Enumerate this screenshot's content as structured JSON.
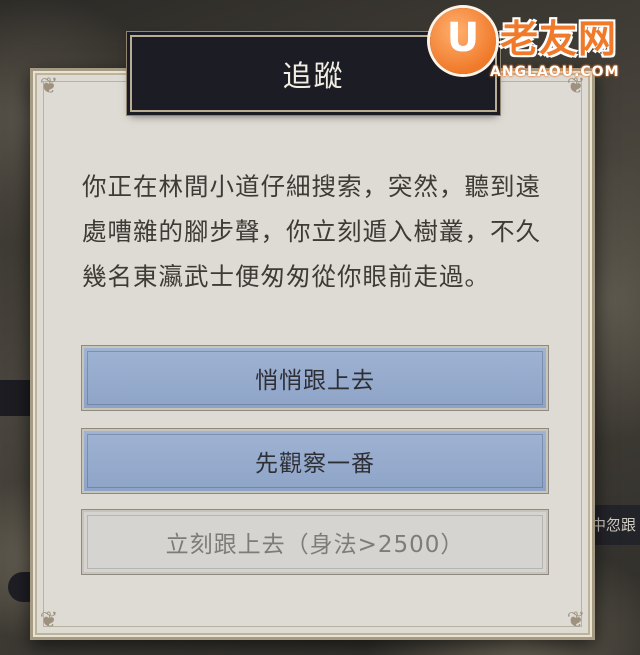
{
  "dialog": {
    "title": "追蹤",
    "description": "你正在林間小道仔細搜索，突然，聽到遠處嘈雜的腳步聲，你立刻遁入樹叢，不久幾名東瀛武士便匆匆從你眼前走過。",
    "choices": [
      {
        "label": "悄悄跟上去",
        "state": "enabled"
      },
      {
        "label": "先觀察一番",
        "state": "enabled"
      },
      {
        "label": "立刻跟上去（身法>2500）",
        "state": "disabled"
      }
    ]
  },
  "background": {
    "side_text": "中忽跟"
  },
  "watermark": {
    "mark": "U",
    "brand": "老友网",
    "site": "ANGLAOU.COM"
  },
  "colors": {
    "panel": "#dedad4",
    "title_plate": "#1c1d24",
    "choice_active": "#9fb3d3",
    "choice_disabled": "#d6d4d1",
    "brand_orange": "#f07a2a"
  }
}
